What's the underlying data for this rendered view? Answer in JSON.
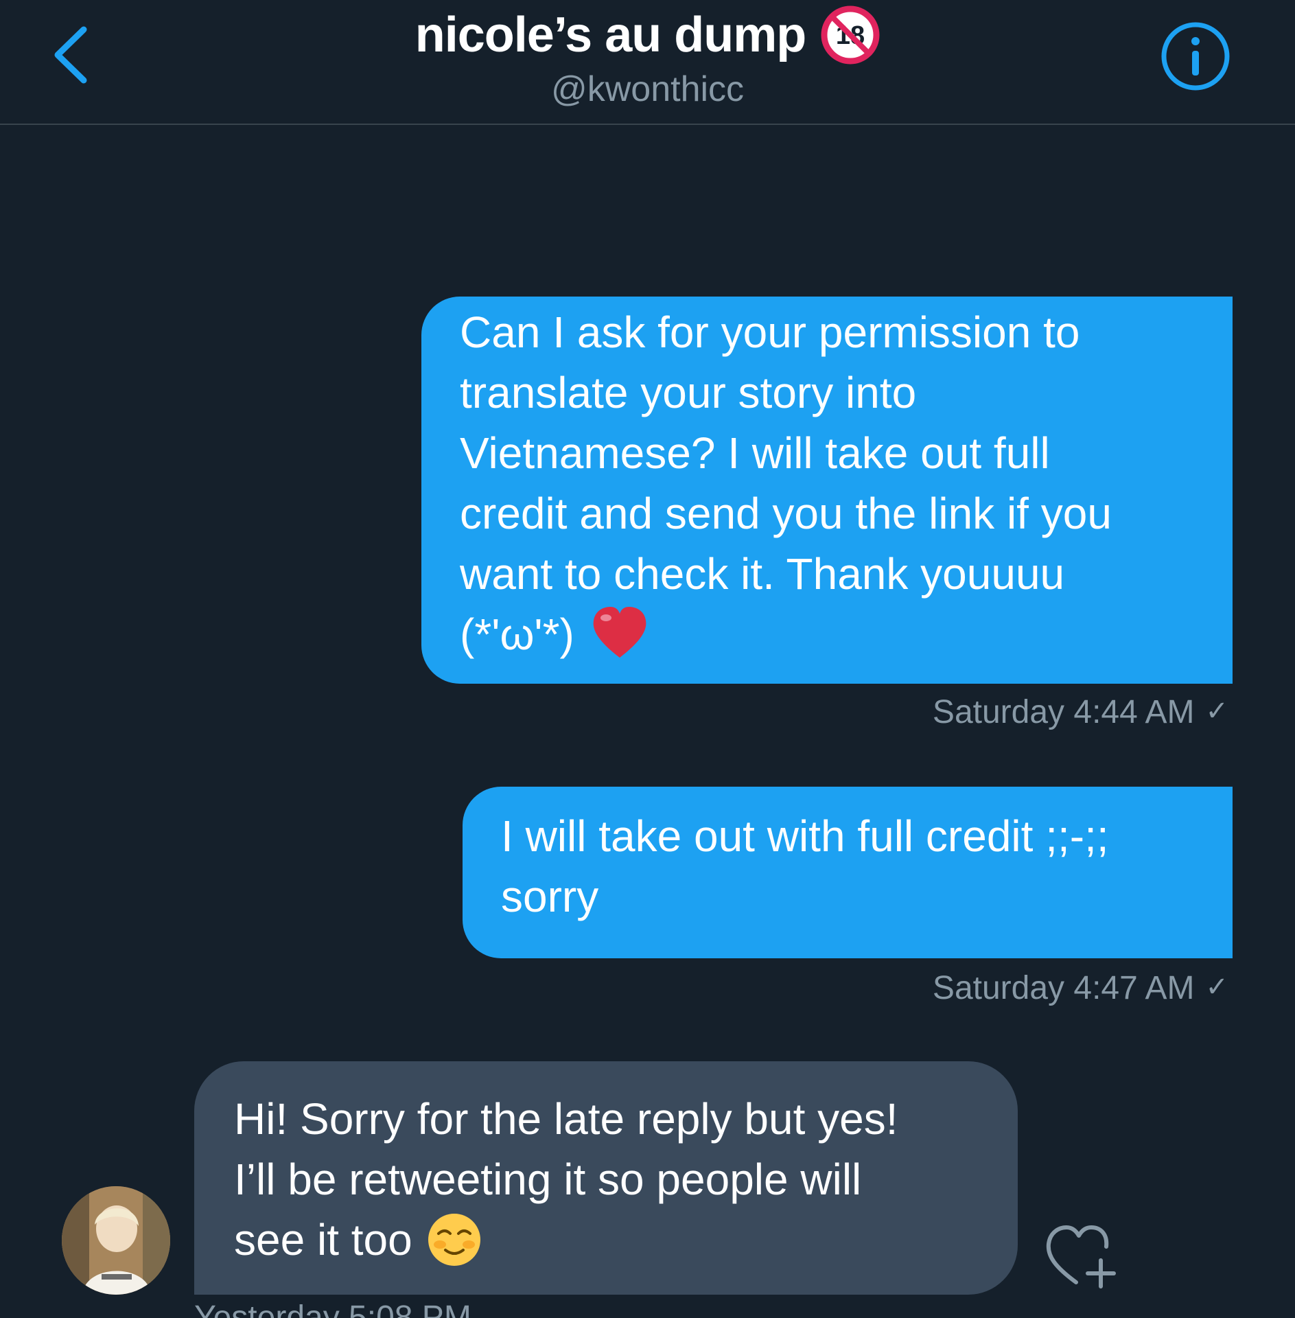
{
  "header": {
    "title": "nicole’s au dump",
    "handle": "@kwonthicc",
    "icons": {
      "back": "chevron-left-icon",
      "age_badge": "no-under-18-icon",
      "info": "info-icon"
    },
    "badge_text": "18"
  },
  "colors": {
    "background": "#15202b",
    "accent": "#1da1f2",
    "incoming_bubble": "#3a4a5c",
    "muted_text": "#8899a6",
    "age_badge_red": "#e0245e"
  },
  "messages": [
    {
      "direction": "outgoing",
      "lines": [
        "Can I ask for your permission to",
        "translate your story into",
        "Vietnamese? I will take out full",
        "credit and send you the link if you",
        "want to check it. Thank youuuu",
        "(*'ω'*)"
      ],
      "emoji": "red-heart-emoji",
      "timestamp": "Saturday 4:44 AM",
      "status": "✓"
    },
    {
      "direction": "outgoing",
      "lines": [
        "I will take out with full credit ;;-;;",
        "sorry"
      ],
      "timestamp": "Saturday 4:47 AM",
      "status": "✓"
    },
    {
      "direction": "incoming",
      "lines": [
        "Hi! Sorry for the late reply but yes!",
        "I’ll be retweeting it so people will",
        "see it too"
      ],
      "emoji": "smiling-face-emoji",
      "timestamp": "Yesterday 5:08 PM"
    }
  ]
}
